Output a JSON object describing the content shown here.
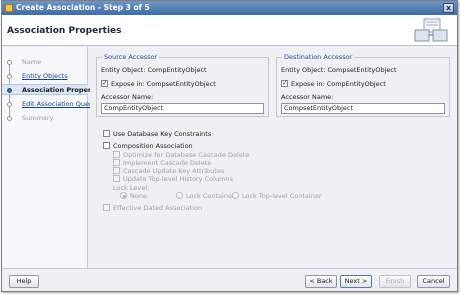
{
  "window": {
    "title": "Create Association - Step 3 of 5",
    "close_label": "x"
  },
  "header": {
    "title": "Association Properties"
  },
  "sidebar": {
    "steps": [
      {
        "label": "Name"
      },
      {
        "label": "Entity Objects"
      },
      {
        "label": "Association Properti"
      },
      {
        "label": "Edit Association Query"
      },
      {
        "label": "Summary"
      }
    ]
  },
  "source": {
    "legend": "Source Accessor",
    "entity_object": "Entity Object: CompEntityObject",
    "expose_label": "Expose in: CompsetEntityObject",
    "expose_checked": true,
    "accessor_name_label": "Accessor Name:",
    "accessor_name_value": "CompEntityObject"
  },
  "destination": {
    "legend": "Destination Accessor",
    "entity_object": "Entity Object: CompsetEntityObject",
    "expose_label": "Expose in: CompEntityObject",
    "expose_checked": true,
    "accessor_name_label": "Accessor Name:",
    "accessor_name_value": "CompsetEntityObject"
  },
  "options": {
    "use_db_key_constraints": "Use Database Key Constraints",
    "composition_association": "Composition Association",
    "optimize_cascade_delete": "Optimize for Database Cascade Delete",
    "implement_cascade_delete": "Implement Cascade Delete",
    "cascade_update_key": "Cascade Update Key Attributes",
    "update_top_level_history": "Update Top-level History Columns",
    "lock_level_label": "Lock Level:",
    "lock_none": "None",
    "lock_container": "Lock Container",
    "lock_top_level_container": "Lock Top-level Container",
    "effective_dated": "Effective Dated Association"
  },
  "buttons": {
    "help": "Help",
    "back": "< Back",
    "next": "Next >",
    "finish": "Finish",
    "cancel": "Cancel"
  }
}
